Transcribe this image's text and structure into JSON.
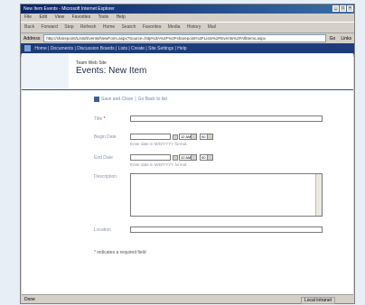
{
  "window": {
    "title": "New Item Events - Microsoft Internet Explorer",
    "controls": [
      "_",
      "□",
      "×"
    ]
  },
  "menubar": [
    "File",
    "Edit",
    "View",
    "Favorites",
    "Tools",
    "Help"
  ],
  "toolbar": [
    "Back",
    "Forward",
    "Stop",
    "Refresh",
    "Home",
    "Search",
    "Favorites",
    "Media",
    "History",
    "Mail"
  ],
  "addressbar": {
    "label": "Address",
    "url": "http://sharepoint/Lists/Events/NewForm.aspx?Source=http%3A%2F%2Fsharepoint%2FLists%2FEvents%2FAllItems.aspx",
    "go": "Go",
    "links": "Links"
  },
  "nav": {
    "items": [
      "Home",
      "Documents",
      "Discussion Boards",
      "Lists",
      "Create",
      "Site Settings",
      "Help"
    ]
  },
  "page": {
    "site_title": "Team Web Site",
    "title": "Events: New Item"
  },
  "actions": {
    "save": "Save and Close",
    "back": "Go Back to list"
  },
  "form": {
    "title_label": "Title",
    "required_mark": "*",
    "begin_label": "Begin Date",
    "begin_time": "12 AM",
    "begin_min": "00",
    "end_label": "End Date",
    "end_time": "12 AM",
    "end_min": "00",
    "date_hint": "Enter date in M/D/YYYY format.",
    "desc_label": "Description",
    "location_label": "Location",
    "required_note": "* indicates a required field"
  },
  "status": {
    "left": "Done",
    "zone": "Local intranet"
  }
}
